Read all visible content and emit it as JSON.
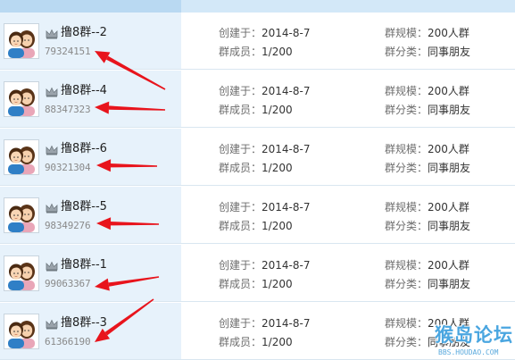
{
  "labels": {
    "created": "创建于：",
    "members": "群成员：",
    "scale": "群规模：",
    "category": "群分类："
  },
  "groups": [
    {
      "name": "撸8群--2",
      "id": "79324151",
      "created": "2014-8-7",
      "members": "1/200",
      "scale": "200人群",
      "category": "同事朋友"
    },
    {
      "name": "撸8群--4",
      "id": "88347323",
      "created": "2014-8-7",
      "members": "1/200",
      "scale": "200人群",
      "category": "同事朋友"
    },
    {
      "name": "撸8群--6",
      "id": "90321304",
      "created": "2014-8-7",
      "members": "1/200",
      "scale": "200人群",
      "category": "同事朋友"
    },
    {
      "name": "撸8群--5",
      "id": "98349276",
      "created": "2014-8-7",
      "members": "1/200",
      "scale": "200人群",
      "category": "同事朋友"
    },
    {
      "name": "撸8群--1",
      "id": "99063367",
      "created": "2014-8-7",
      "members": "1/200",
      "scale": "200人群",
      "category": "同事朋友"
    },
    {
      "name": "撸8群--3",
      "id": "61366190",
      "created": "2014-8-7",
      "members": "1/200",
      "scale": "200人群",
      "category": "同事朋友"
    }
  ],
  "colors": {
    "left_column": "#e7f2fb",
    "header_left": "#b9d9f2",
    "header_right": "#d3e8f8",
    "annotation_arrow": "#e8141c",
    "watermark": "#4aa6e0"
  },
  "icons": {
    "avatar": "group-avatar-icon",
    "owner_badge": "crown-icon"
  },
  "watermark": {
    "text": "猴岛论坛",
    "url": "BBS.HOUDAO.COM"
  }
}
